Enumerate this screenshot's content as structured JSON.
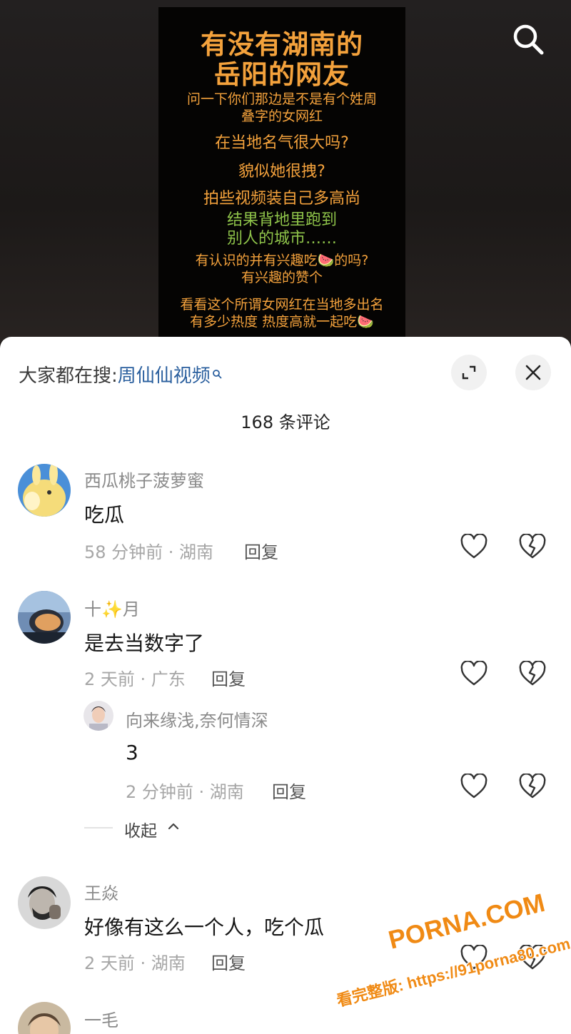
{
  "video": {
    "poster_lines": [
      "有没有湖南的",
      "岳阳的网友",
      "问一下你们那边是不是有个姓周",
      "叠字的女网红",
      "在当地名气很大吗?",
      "貌似她很拽?",
      "拍些视频装自己多高尚",
      "结果背地里跑到",
      "别人的城市……",
      "有认识的并有兴趣吃🍉的吗?",
      "有兴趣的赞个",
      "看看这个所谓女网红在当地多出名",
      "有多少热度 热度高就一起吃🍉"
    ]
  },
  "sheet": {
    "hot_search_prefix": "大家都在搜:",
    "hot_search_keyword": "周仙仙视频",
    "comment_count": "168 条评论",
    "reply_label": "回复",
    "collapse_label": "收起",
    "comments": [
      {
        "name": "西瓜桃子菠萝蜜",
        "text": "吃瓜",
        "meta": "58 分钟前 · 湖南"
      },
      {
        "name": "十✨月",
        "text": "是去当数字了",
        "meta": "2 天前 · 广东"
      },
      {
        "name": "向来缘浅,奈何情深",
        "text": "3",
        "meta": "2 分钟前 · 湖南"
      },
      {
        "name": "王焱",
        "text": "好像有这么一个人，吃个瓜",
        "meta": "2 天前 · 湖南"
      },
      {
        "name": "一毛",
        "text": "",
        "meta": ""
      }
    ]
  },
  "watermark": {
    "logo": "PORNA.COM",
    "line": "看完整版: https://91porna80.com"
  },
  "colors": {
    "poster_orange": "#f4a23c",
    "poster_green": "#8fc44a",
    "keyword_blue": "#2a5f9e",
    "watermark_orange": "#f08a14"
  }
}
